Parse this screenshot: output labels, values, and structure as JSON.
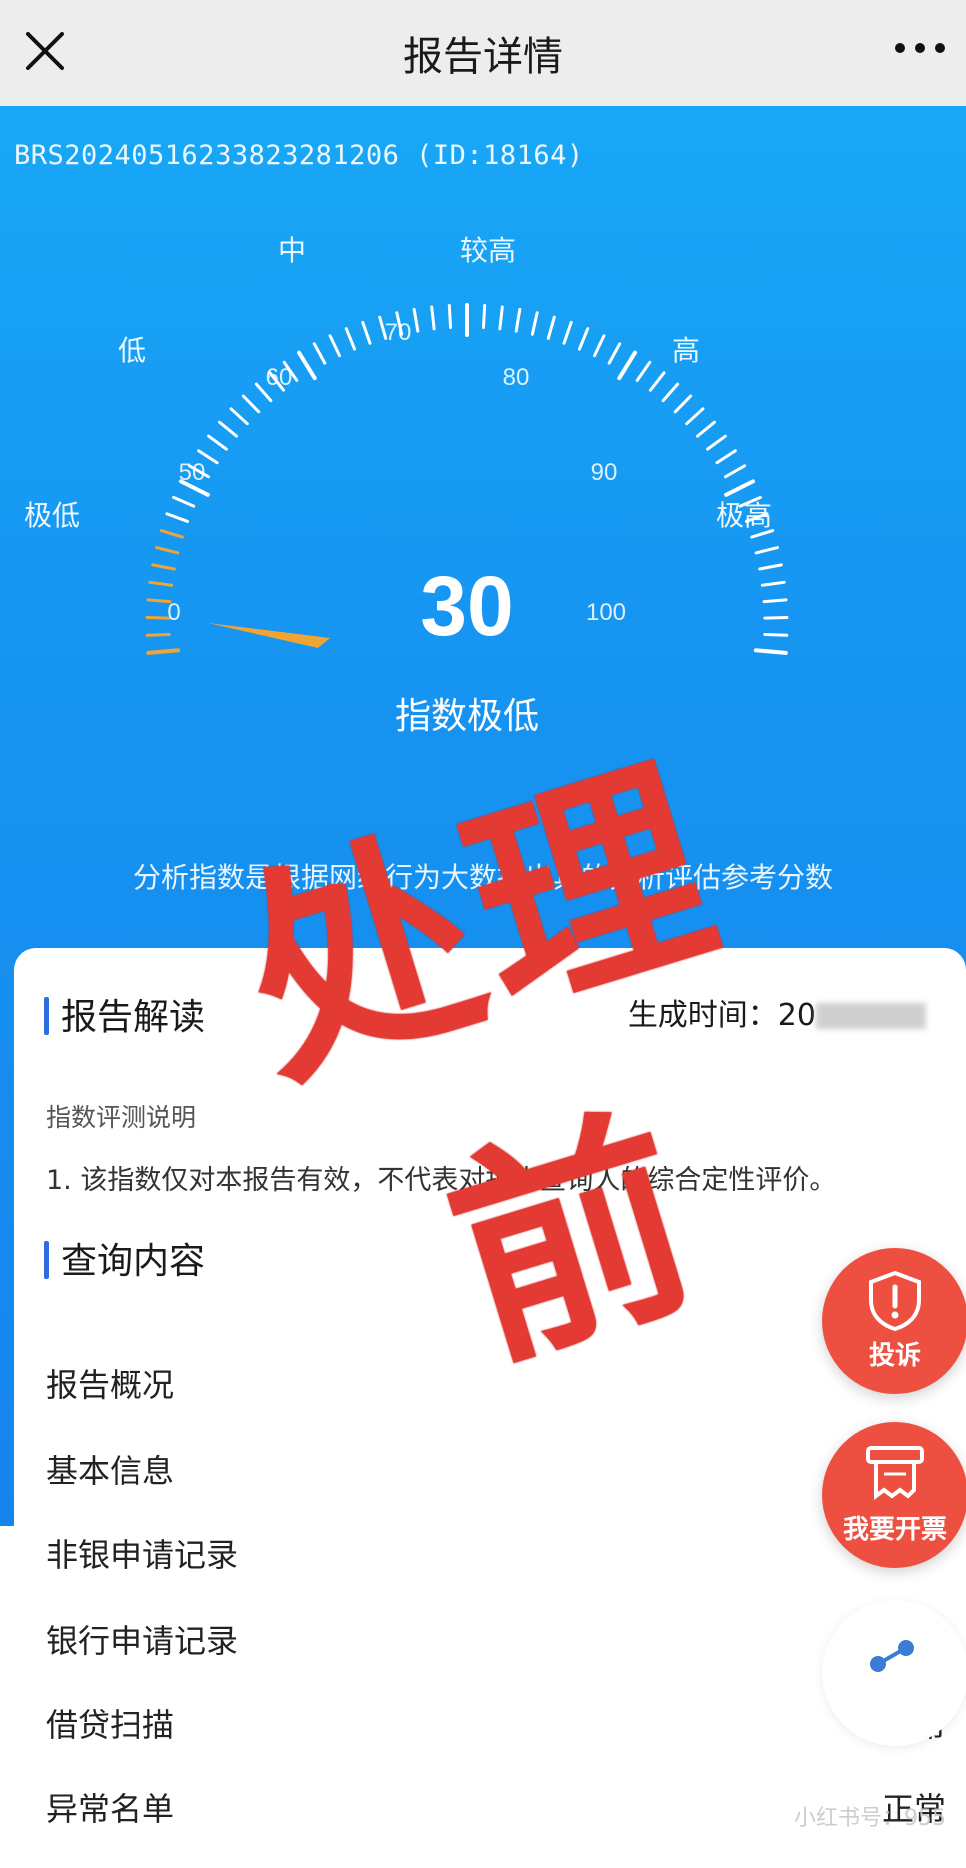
{
  "nav": {
    "title": "报告详情",
    "close_icon": "close-icon",
    "more_icon": "more-dots-icon"
  },
  "report": {
    "number": "BRS20240516233823281206 (ID:18164)"
  },
  "gauge": {
    "score": "30",
    "status": "指数极低",
    "zones": [
      "极低",
      "低",
      "中",
      "较高",
      "高",
      "极高"
    ],
    "scale_labels": [
      "0",
      "50",
      "60",
      "70",
      "80",
      "90",
      "100"
    ],
    "score_value": 30,
    "accent_color": "#f0a533"
  },
  "tip": "分析指数是根据网络行为大数据出具的分析评估参考分数",
  "stamp": "处理前",
  "card": {
    "interpretation_title": "报告解读",
    "generated_label": "生成时间：20",
    "desc_header": "指数评测说明",
    "desc_1": "1. 该指数仅对本报告有效，不代表对报告查询人的综合定性评价。",
    "query_title": "查询内容",
    "rows": [
      {
        "label": "报告概况",
        "status": ""
      },
      {
        "label": "基本信息",
        "status": ""
      },
      {
        "label": "非银申请记录",
        "status": ""
      },
      {
        "label": "银行申请记录",
        "status": ""
      },
      {
        "label": "借贷扫描",
        "status": "正常"
      },
      {
        "label": "异常名单",
        "status": "正常"
      }
    ]
  },
  "fabs": {
    "complaint": "投诉",
    "invoice": "我要开票",
    "complaint_icon": "shield-alert-icon",
    "invoice_icon": "receipt-icon",
    "share_icon": "share-icon"
  },
  "watermark": "小红书号：955"
}
